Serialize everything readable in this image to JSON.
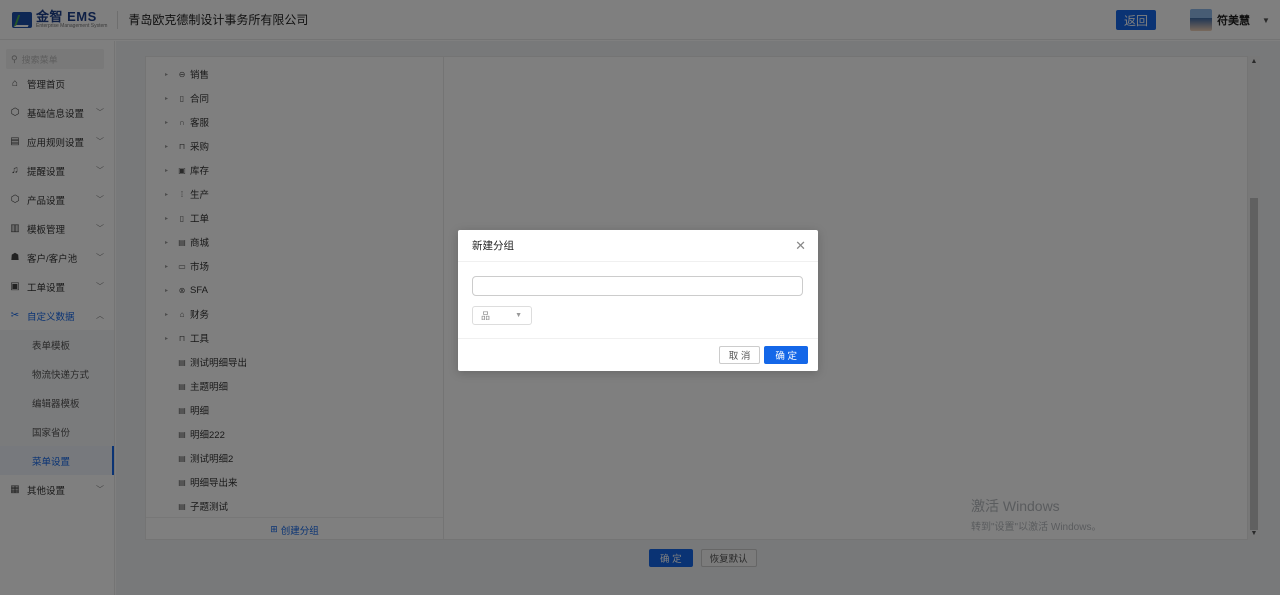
{
  "header": {
    "logo_name": "金智 EMS",
    "logo_sub": "Enterprise Management System",
    "company": "青岛欧克德制设计事务所有限公司",
    "back_label": "返回",
    "user_name": "符美慧"
  },
  "sidebar": {
    "search_placeholder": "搜索菜单",
    "items": [
      {
        "label": "管理首页",
        "icon": "home-icon",
        "glyph": "⌂",
        "has_chevron": false
      },
      {
        "label": "基础信息设置",
        "icon": "cube-icon",
        "glyph": "⬡",
        "has_chevron": true
      },
      {
        "label": "应用规则设置",
        "icon": "document-icon",
        "glyph": "▤",
        "has_chevron": true
      },
      {
        "label": "提醒设置",
        "icon": "bell-icon",
        "glyph": "♫",
        "has_chevron": true
      },
      {
        "label": "产品设置",
        "icon": "box-icon",
        "glyph": "⬡",
        "has_chevron": true
      },
      {
        "label": "模板管理",
        "icon": "template-icon",
        "glyph": "▥",
        "has_chevron": true
      },
      {
        "label": "客户/客户池",
        "icon": "users-icon",
        "glyph": "☗",
        "has_chevron": true
      },
      {
        "label": "工单设置",
        "icon": "ticket-icon",
        "glyph": "▣",
        "has_chevron": true
      },
      {
        "label": "自定义数据",
        "icon": "tools-icon",
        "glyph": "✂",
        "has_chevron": true,
        "open": true
      }
    ],
    "sub_items": [
      {
        "label": "表单模板"
      },
      {
        "label": "物流快递方式"
      },
      {
        "label": "编辑器模板"
      },
      {
        "label": "国家省份"
      },
      {
        "label": "菜单设置",
        "active": true
      }
    ],
    "bottom_item": {
      "label": "其他设置",
      "icon": "grid-icon",
      "glyph": "▦"
    }
  },
  "tree": {
    "groups": [
      {
        "label": "销售",
        "icon": "sales-icon",
        "glyph": "⊖"
      },
      {
        "label": "合同",
        "icon": "contract-icon",
        "glyph": "▯"
      },
      {
        "label": "客服",
        "icon": "headset-icon",
        "glyph": "∩"
      },
      {
        "label": "采购",
        "icon": "cart-icon",
        "glyph": "⊓"
      },
      {
        "label": "库存",
        "icon": "warehouse-icon",
        "glyph": "▣"
      },
      {
        "label": "生产",
        "icon": "factory-icon",
        "glyph": "⁞"
      },
      {
        "label": "工单",
        "icon": "ticket-icon",
        "glyph": "▯"
      },
      {
        "label": "商城",
        "icon": "shop-icon",
        "glyph": "▤"
      },
      {
        "label": "市场",
        "icon": "market-icon",
        "glyph": "▭"
      },
      {
        "label": "SFA",
        "icon": "sfa-icon",
        "glyph": "⊗"
      },
      {
        "label": "财务",
        "icon": "finance-icon",
        "glyph": "⌂"
      },
      {
        "label": "工具",
        "icon": "toolbox-icon",
        "glyph": "⊓"
      }
    ],
    "leaves": [
      {
        "label": "测试明细导出"
      },
      {
        "label": "主题明细"
      },
      {
        "label": "明细"
      },
      {
        "label": "明细222"
      },
      {
        "label": "测试明细2"
      },
      {
        "label": "明细导出来"
      },
      {
        "label": "子题测试"
      }
    ],
    "create_group_label": "创建分组"
  },
  "footer": {
    "confirm_label": "确 定",
    "reset_label": "恢复默认"
  },
  "watermark": {
    "title": "激活 Windows",
    "sub": "转到\"设置\"以激活 Windows。"
  },
  "modal": {
    "title": "新建分组",
    "name_value": "",
    "icon_select_glyph": "品",
    "cancel_label": "取 消",
    "ok_label": "确 定"
  }
}
